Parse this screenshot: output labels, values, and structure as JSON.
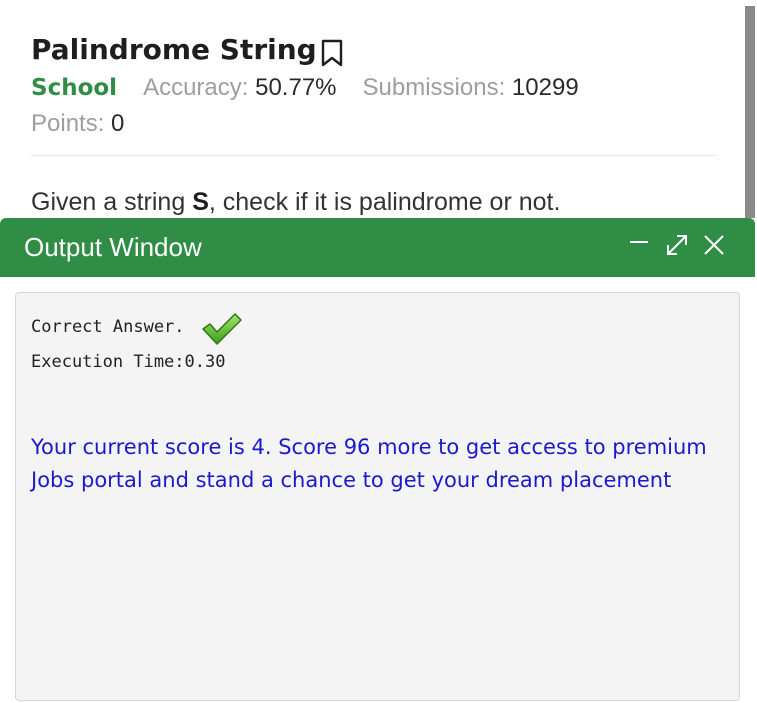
{
  "problem": {
    "title": "Palindrome String",
    "difficulty": "School",
    "accuracy_label": "Accuracy:",
    "accuracy_value": "50.77%",
    "submissions_label": "Submissions:",
    "submissions_value": "10299",
    "points_label": "Points:",
    "points_value": "0",
    "description_pre": "Given a string ",
    "description_var": "S",
    "description_post": ", check if it is palindrome or not."
  },
  "output_window": {
    "title": "Output Window",
    "result_text": "Correct Answer.",
    "execution_time": "Execution Time:0.30",
    "score_message": "Your current score is 4. Score 96 more to get access to premium Jobs portal and stand a chance to get your dream placement"
  },
  "icons": {
    "bookmark": "bookmark-icon",
    "minimize": "minimize-icon",
    "expand": "expand-icon",
    "close": "close-icon",
    "check": "check-icon"
  },
  "colors": {
    "brand_green": "#2f8d46",
    "score_blue": "#1a1acc",
    "muted_gray": "#9e9e9e"
  }
}
